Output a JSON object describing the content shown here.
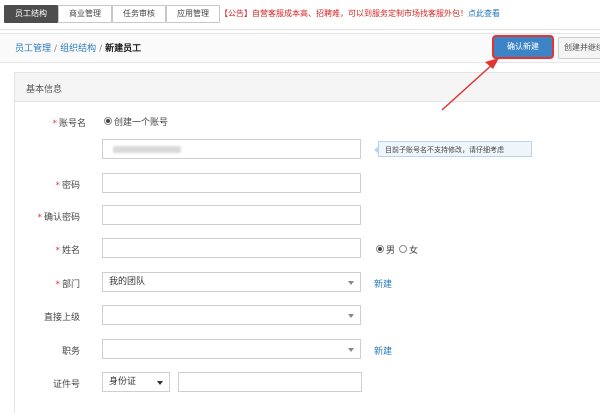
{
  "topnav": {
    "tabs": [
      {
        "label": "员工结构",
        "active": true
      },
      {
        "label": "商业管理",
        "active": false
      },
      {
        "label": "任务审核",
        "active": false
      },
      {
        "label": "应用管理",
        "active": false
      }
    ],
    "notice": "【公告】自营客服成本高、招聘难，可以到服务定制市场找客服外包！",
    "notice_link": "点此查看"
  },
  "breadcrumb": {
    "items": [
      "员工管理",
      "组织结构"
    ],
    "separator": "/",
    "current": "新建员工"
  },
  "actions": {
    "confirm": "确认新建",
    "create_next": "创建并继续"
  },
  "form": {
    "section_title": "基本信息",
    "required_mark": "*",
    "account": {
      "label": "账号名",
      "radio_label": "创建一个账号",
      "tip": "目前子账号名不支持修改，请仔细考虑"
    },
    "password": {
      "label": "密码"
    },
    "confirm_password": {
      "label": "确认密码"
    },
    "name": {
      "label": "姓名"
    },
    "gender": {
      "male": "男",
      "female": "女",
      "selected": "男"
    },
    "department": {
      "label": "部门",
      "value": "我的团队",
      "new_link": "新建"
    },
    "supervisor": {
      "label": "直接上级",
      "value": ""
    },
    "position": {
      "label": "职务",
      "value": "",
      "new_link": "新建"
    },
    "id_number": {
      "label": "证件号",
      "type_value": "身份证"
    }
  },
  "colors": {
    "primary_button": "#3d84c6",
    "highlight": "#e3342f",
    "link": "#2b7bbd",
    "notice": "#d62424"
  }
}
